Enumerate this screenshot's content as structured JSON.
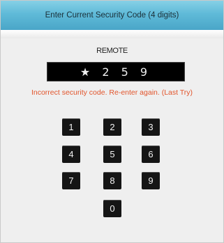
{
  "dialog": {
    "title": "Enter Current Security Code (4 digits)",
    "source_label": "REMOTE",
    "code_display": "★ 2 5 9",
    "error_message": "Incorrect security code. Re-enter again. (Last Try)",
    "colors": {
      "title_bar": "#5fbad8",
      "error_text": "#e2542b",
      "key_background": "#151515"
    }
  },
  "keypad": {
    "keys": [
      "1",
      "2",
      "3",
      "4",
      "5",
      "6",
      "7",
      "8",
      "9",
      "0"
    ]
  }
}
